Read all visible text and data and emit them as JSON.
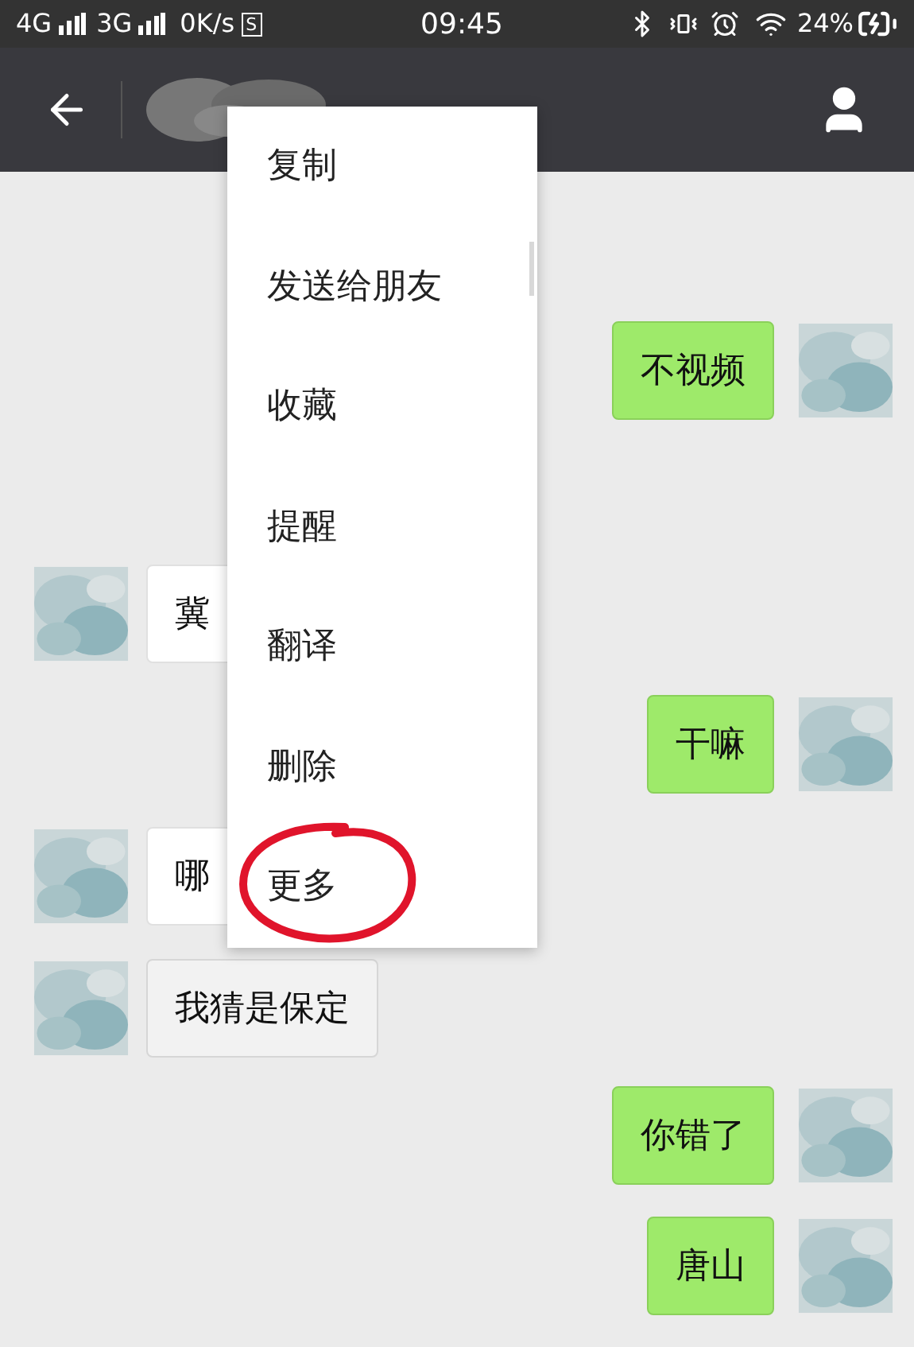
{
  "status_bar": {
    "network_1": "4G",
    "network_2": "3G",
    "speed": "0K/s",
    "sim_badge": "S",
    "time": "09:45",
    "battery": "24%"
  },
  "menu": {
    "items": [
      {
        "label": "复制",
        "highlighted": false
      },
      {
        "label": "发送给朋友",
        "highlighted": false
      },
      {
        "label": "收藏",
        "highlighted": false
      },
      {
        "label": "提醒",
        "highlighted": false
      },
      {
        "label": "翻译",
        "highlighted": false
      },
      {
        "label": "删除",
        "highlighted": false
      },
      {
        "label": "更多",
        "highlighted": true
      }
    ]
  },
  "messages": [
    {
      "kind": "sent",
      "text": "不视频",
      "pressed": false
    },
    {
      "kind": "received",
      "text": "冀",
      "pressed": false
    },
    {
      "kind": "sent",
      "text": "干嘛",
      "pressed": false
    },
    {
      "kind": "received",
      "text": "哪",
      "pressed": false
    },
    {
      "kind": "received",
      "text": "我猜是保定",
      "pressed": true
    },
    {
      "kind": "sent",
      "text": "你错了",
      "pressed": false
    },
    {
      "kind": "sent",
      "text": "唐山",
      "pressed": false
    }
  ]
}
